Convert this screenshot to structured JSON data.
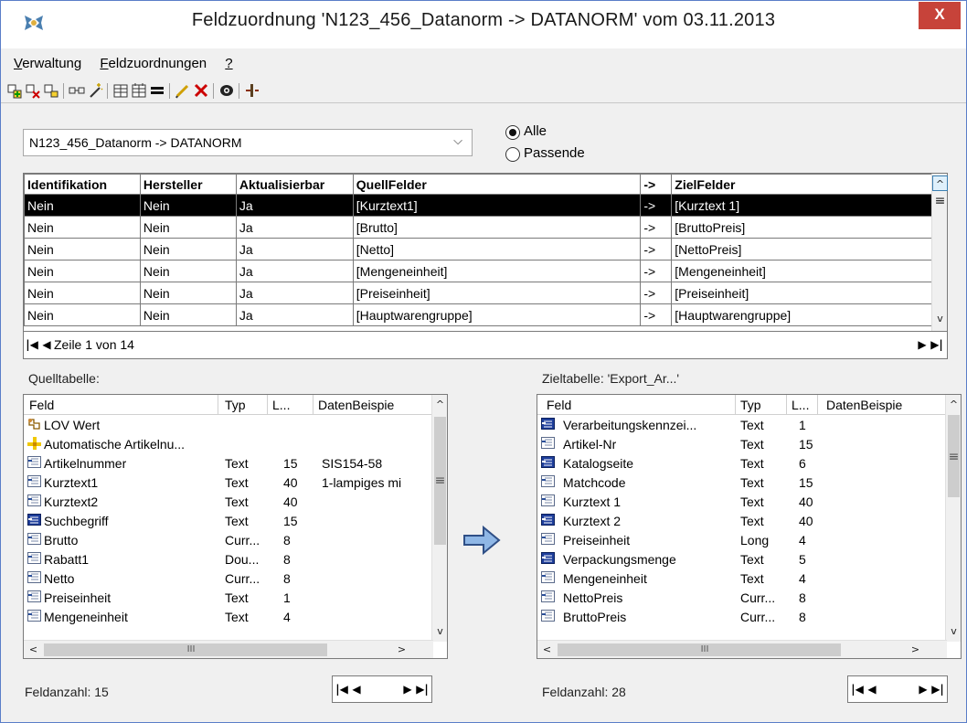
{
  "window": {
    "title": "Feldzuordnung  'N123_456_Datanorm -> DATANORM'  vom 03.11.2013",
    "close_label": "X"
  },
  "menu": [
    {
      "label": "Verwaltung",
      "accel": "V"
    },
    {
      "label": "Feldzuordnungen",
      "accel": "F"
    },
    {
      "label": "?",
      "accel": "?"
    }
  ],
  "filter": {
    "combo_value": "N123_456_Datanorm -> DATANORM",
    "radio_all": "Alle",
    "radio_matching": "Passende",
    "selected": "Alle"
  },
  "grid": {
    "columns": [
      "Identifikation",
      "Hersteller",
      "Aktualisierbar",
      "QuellFelder",
      "->",
      "ZielFelder"
    ],
    "rows": [
      [
        "Nein",
        "Nein",
        "Ja",
        "[Kurztext1]",
        "->",
        "[Kurztext 1]"
      ],
      [
        "Nein",
        "Nein",
        "Ja",
        "[Brutto]",
        "->",
        "[BruttoPreis]"
      ],
      [
        "Nein",
        "Nein",
        "Ja",
        "[Netto]",
        "->",
        "[NettoPreis]"
      ],
      [
        "Nein",
        "Nein",
        "Ja",
        "[Mengeneinheit]",
        "->",
        "[Mengeneinheit]"
      ],
      [
        "Nein",
        "Nein",
        "Ja",
        "[Preiseinheit]",
        "->",
        "[Preiseinheit]"
      ],
      [
        "Nein",
        "Nein",
        "Ja",
        "[Hauptwarengruppe]",
        "->",
        "[Hauptwarengruppe]"
      ]
    ],
    "selected_row": 0,
    "nav_text": "Zeile 1 von 14"
  },
  "source": {
    "label": "Quelltabelle:",
    "columns": [
      "Feld",
      "Typ",
      "L...",
      "DatenBeispie"
    ],
    "rows": [
      {
        "icon": "lov-icon",
        "name": "LOV Wert",
        "type": "",
        "len": "",
        "sample": ""
      },
      {
        "icon": "autonumber-icon",
        "name": "Automatische Artikelnu...",
        "type": "",
        "len": "",
        "sample": ""
      },
      {
        "icon": "field-icon",
        "name": "Artikelnummer",
        "type": "Text",
        "len": "15",
        "sample": "SIS154-58"
      },
      {
        "icon": "field-icon",
        "name": "Kurztext1",
        "type": "Text",
        "len": "40",
        "sample": "1-lampiges mi"
      },
      {
        "icon": "field-icon",
        "name": "Kurztext2",
        "type": "Text",
        "len": "40",
        "sample": ""
      },
      {
        "icon": "key-field-icon",
        "name": "Suchbegriff",
        "type": "Text",
        "len": "15",
        "sample": ""
      },
      {
        "icon": "field-icon",
        "name": "Brutto",
        "type": "Curr...",
        "len": "8",
        "sample": ""
      },
      {
        "icon": "field-icon",
        "name": "Rabatt1",
        "type": "Dou...",
        "len": "8",
        "sample": ""
      },
      {
        "icon": "field-icon",
        "name": "Netto",
        "type": "Curr...",
        "len": "8",
        "sample": ""
      },
      {
        "icon": "field-icon",
        "name": "Preiseinheit",
        "type": "Text",
        "len": "1",
        "sample": ""
      },
      {
        "icon": "field-icon",
        "name": "Mengeneinheit",
        "type": "Text",
        "len": "4",
        "sample": ""
      }
    ],
    "count_text": "Feldanzahl: 15"
  },
  "target": {
    "label": "Zieltabelle: 'Export_Ar...'",
    "columns": [
      "Feld",
      "Typ",
      "L...",
      "DatenBeispie"
    ],
    "rows": [
      {
        "icon": "key-field-icon",
        "name": "Verarbeitungskennzei...",
        "type": "Text",
        "len": "1"
      },
      {
        "icon": "field-icon",
        "name": "Artikel-Nr",
        "type": "Text",
        "len": "15"
      },
      {
        "icon": "key-field-icon",
        "name": "Katalogseite",
        "type": "Text",
        "len": "6"
      },
      {
        "icon": "field-icon",
        "name": "Matchcode",
        "type": "Text",
        "len": "15"
      },
      {
        "icon": "field-icon",
        "name": "Kurztext 1",
        "type": "Text",
        "len": "40"
      },
      {
        "icon": "key-field-icon",
        "name": "Kurztext 2",
        "type": "Text",
        "len": "40"
      },
      {
        "icon": "field-icon",
        "name": "Preiseinheit",
        "type": "Long",
        "len": "4"
      },
      {
        "icon": "key-field-icon",
        "name": "Verpackungsmenge",
        "type": "Text",
        "len": "5"
      },
      {
        "icon": "field-icon",
        "name": "Mengeneinheit",
        "type": "Text",
        "len": "4"
      },
      {
        "icon": "field-icon",
        "name": "NettoPreis",
        "type": "Curr...",
        "len": "8"
      },
      {
        "icon": "field-icon",
        "name": "BruttoPreis",
        "type": "Curr...",
        "len": "8"
      }
    ],
    "count_text": "Feldanzahl: 28"
  },
  "icons": {
    "scroll_up": "^",
    "scroll_down": "v",
    "scroll_left": "<",
    "scroll_right": ">",
    "thumb_grip": "≡",
    "hscroll_grip": "III",
    "first": "|◀",
    "prev": "◀",
    "next": "▶",
    "last": "▶|"
  },
  "colors": {
    "selected_row_bg": "#000000",
    "close_button": "#c7433a",
    "key_icon": "#1f3f9c"
  }
}
